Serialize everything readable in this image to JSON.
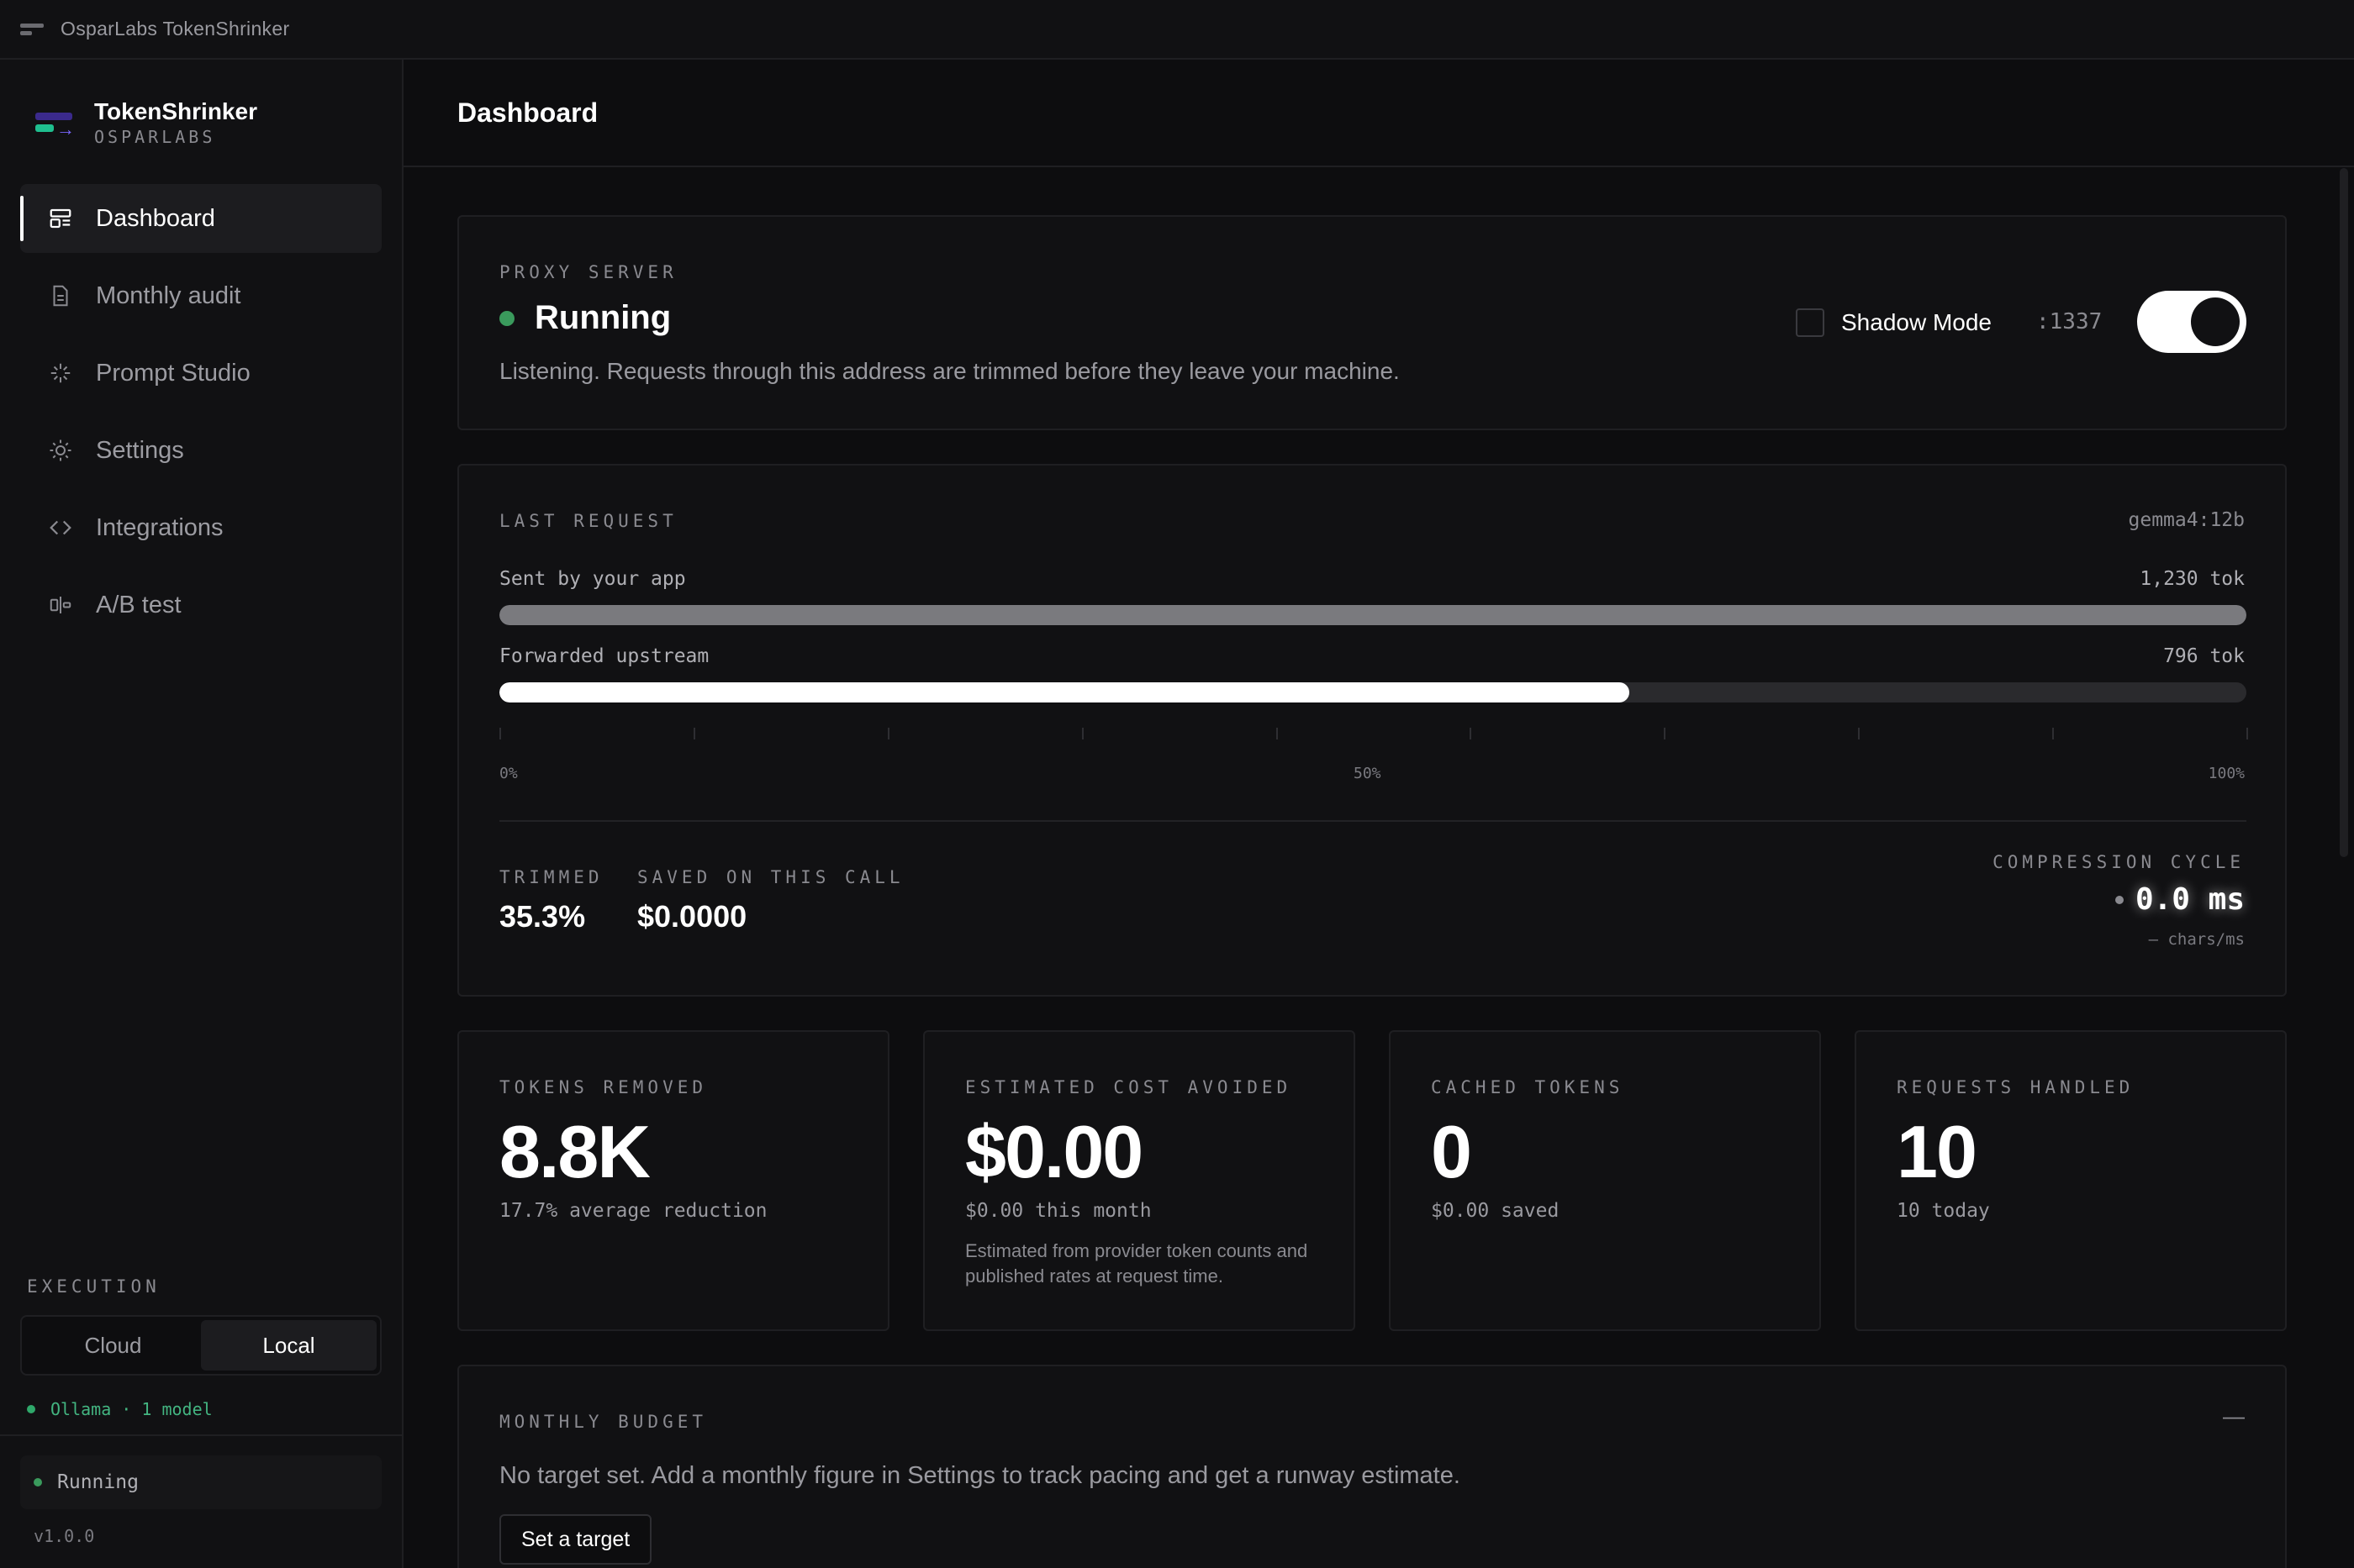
{
  "window": {
    "title": "OsparLabs TokenShrinker"
  },
  "brand": {
    "name": "TokenShrinker",
    "sub": "OSPARLABS"
  },
  "nav": [
    {
      "label": "Dashboard",
      "icon": "dashboard-icon",
      "active": true
    },
    {
      "label": "Monthly audit",
      "icon": "document-icon",
      "active": false
    },
    {
      "label": "Prompt Studio",
      "icon": "sparkle-icon",
      "active": false
    },
    {
      "label": "Settings",
      "icon": "gear-icon",
      "active": false
    },
    {
      "label": "Integrations",
      "icon": "code-icon",
      "active": false
    },
    {
      "label": "A/B test",
      "icon": "ab-test-icon",
      "active": false
    }
  ],
  "execution": {
    "label": "EXECUTION",
    "options": [
      "Cloud",
      "Local"
    ],
    "selected": "Local",
    "backend": "Ollama · 1 model"
  },
  "sidebar_status": {
    "text": "Running",
    "version": "v1.0.0"
  },
  "header": {
    "title": "Dashboard"
  },
  "proxy": {
    "label": "PROXY SERVER",
    "status": "Running",
    "description": "Listening. Requests through this address are trimmed before they leave your machine.",
    "shadow_mode_label": "Shadow Mode",
    "shadow_mode_checked": false,
    "port": ":1337",
    "enabled": true
  },
  "last_request": {
    "label": "LAST REQUEST",
    "model": "gemma4:12b",
    "sent_label": "Sent by your app",
    "sent_value": "1,230 tok",
    "sent_fraction": 1.0,
    "forwarded_label": "Forwarded upstream",
    "forwarded_value": "796 tok",
    "forwarded_fraction": 0.647,
    "axis": [
      "0%",
      "50%",
      "100%"
    ],
    "trimmed_label": "TRIMMED",
    "trimmed_value": "35.3%",
    "saved_label": "SAVED ON THIS CALL",
    "saved_value": "$0.0000",
    "cycle_label": "COMPRESSION CYCLE",
    "cycle_value": "0.0 ms",
    "cycle_sub": "— chars/ms"
  },
  "stats": [
    {
      "label": "TOKENS REMOVED",
      "value": "8.8K",
      "sub": "17.7% average reduction",
      "note": ""
    },
    {
      "label": "ESTIMATED COST AVOIDED",
      "value": "$0.00",
      "sub": "$0.00 this month",
      "note": "Estimated from provider token counts and published rates at request time."
    },
    {
      "label": "CACHED TOKENS",
      "value": "0",
      "sub": "$0.00 saved",
      "note": ""
    },
    {
      "label": "REQUESTS HANDLED",
      "value": "10",
      "sub": "10 today",
      "note": ""
    }
  ],
  "budget": {
    "label": "MONTHLY BUDGET",
    "collapse": "—",
    "text": "No target set. Add a monthly figure in Settings to track pacing and get a runway estimate.",
    "button": "Set a target"
  }
}
